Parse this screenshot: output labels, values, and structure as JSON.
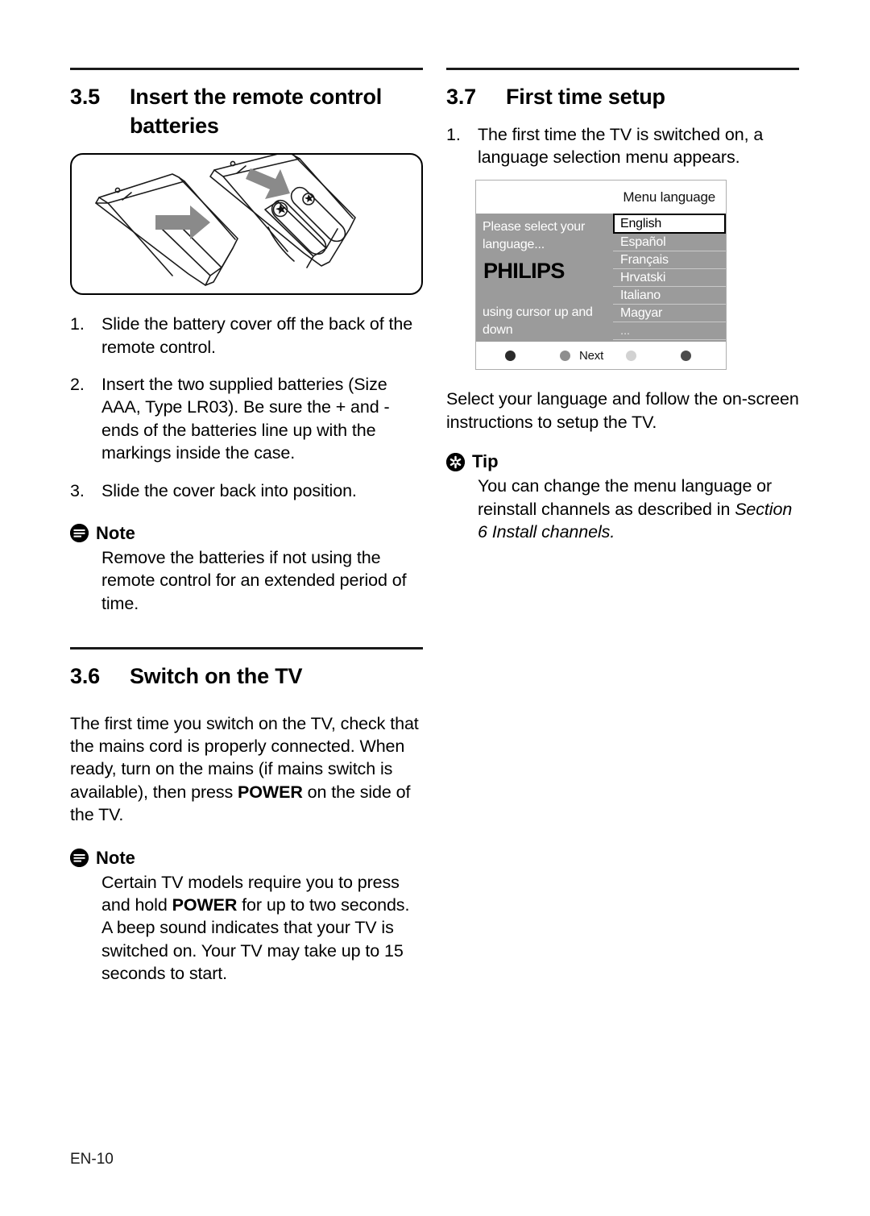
{
  "page": {
    "footer_label": "EN-10"
  },
  "left_column": {
    "section": {
      "number": "3.5",
      "title_line1": "Insert the remote control",
      "title_line2": "batteries"
    },
    "illustration_name": "remote-control-battery-diagram",
    "steps": [
      {
        "num": "1.",
        "text": "Slide the battery cover off the back of the remote control."
      },
      {
        "num": "2.",
        "text": "Insert the two supplied batteries (Size AAA, Type LR03). Be sure the + and - ends of the batteries line up with the markings inside the case."
      },
      {
        "num": "3.",
        "text": "Slide the cover back into position."
      }
    ],
    "note": {
      "icon": "note-icon",
      "label": "Note",
      "body": "Remove the batteries if not using the remote control for an extended period of time."
    },
    "section2": {
      "number": "3.6",
      "title": "Switch on the TV",
      "para_a": "The first time you switch on the TV, check that the mains cord is properly connected. When ready, turn on the mains (if mains switch is available), then press ",
      "para_bold": "POWER",
      "para_b": " on the side of the TV."
    },
    "note2": {
      "icon": "note-icon",
      "label": "Note",
      "body_a": "Certain TV models require you to press and hold ",
      "body_bold": "POWER",
      "body_b": " for up to two seconds. A beep sound indicates that your TV is switched on. Your TV may take up to 15 seconds to start."
    }
  },
  "right_column": {
    "section": {
      "number": "3.7",
      "title": "First time setup"
    },
    "step1": {
      "num": "1.",
      "text": "The first time the TV is switched on, a language selection menu appears."
    },
    "tv_menu": {
      "title": "Menu language",
      "prompt_line1": "Please select your",
      "prompt_line2": "language...",
      "logo": "PHILIPS",
      "hint_line1": "using cursor up and",
      "hint_line2": "down",
      "options": [
        {
          "label": "English",
          "selected": true
        },
        {
          "label": "Español",
          "selected": false
        },
        {
          "label": "Français",
          "selected": false
        },
        {
          "label": "Hrvatski",
          "selected": false
        },
        {
          "label": "Italiano",
          "selected": false
        },
        {
          "label": "Magyar",
          "selected": false
        },
        {
          "label": "...",
          "selected": false
        }
      ],
      "footer_buttons": [
        {
          "label": "",
          "color": "#2b2b2b",
          "name": "nav-dot-1"
        },
        {
          "label": "Next",
          "color": "#8e8e8e",
          "name": "nav-dot-next"
        },
        {
          "label": "",
          "color": "#d2d2d2",
          "name": "nav-dot-3"
        },
        {
          "label": "",
          "color": "#4b4b4b",
          "name": "nav-dot-4"
        }
      ]
    },
    "after_menu_text": "Select your language and follow the on-screen instructions to setup the TV.",
    "tip": {
      "icon": "tip-icon",
      "label": "Tip",
      "body_a": "You can change the menu language or reinstall channels as described in ",
      "body_italic": "Section 6 Install channels."
    }
  }
}
